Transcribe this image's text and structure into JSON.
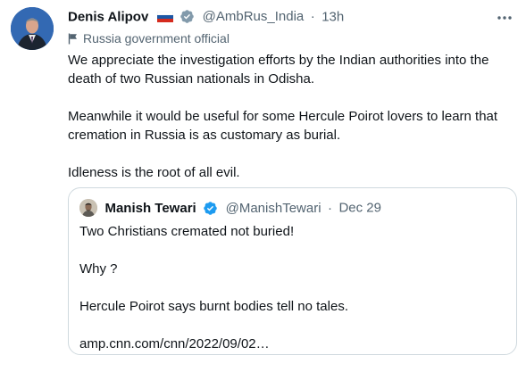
{
  "tweet": {
    "author_name": "Denis Alipov",
    "author_handle": "@AmbRus_India",
    "separator": "·",
    "time": "13h",
    "label": "Russia government official",
    "paragraphs": [
      "We appreciate the investigation efforts by the Indian authorities into the death of two Russian nationals in Odisha.",
      "Meanwhile it would be useful for some Hercule Poirot lovers to learn that cremation in Russia is as customary as burial.",
      "Idleness is the root of all evil."
    ],
    "icons": {
      "avatar": "avatar-photo",
      "flag": "russia-flag-icon",
      "badge": "verified-badge-gray",
      "more": "more-options-icon",
      "label_icon": "flag-outline-icon"
    },
    "colors": {
      "badge": "#829aab",
      "label": "#536471"
    }
  },
  "quote": {
    "author_name": "Manish Tewari",
    "author_handle": "@ManishTewari",
    "separator": "·",
    "time": "Dec 29",
    "lines": [
      "Two Christians cremated not buried!",
      "Why ?",
      "Hercule Poirot says burnt bodies tell no tales.",
      "amp.cnn.com/cnn/2022/09/02…"
    ],
    "colors": {
      "badge": "#1d9bf0",
      "border": "#cfd9de"
    }
  }
}
